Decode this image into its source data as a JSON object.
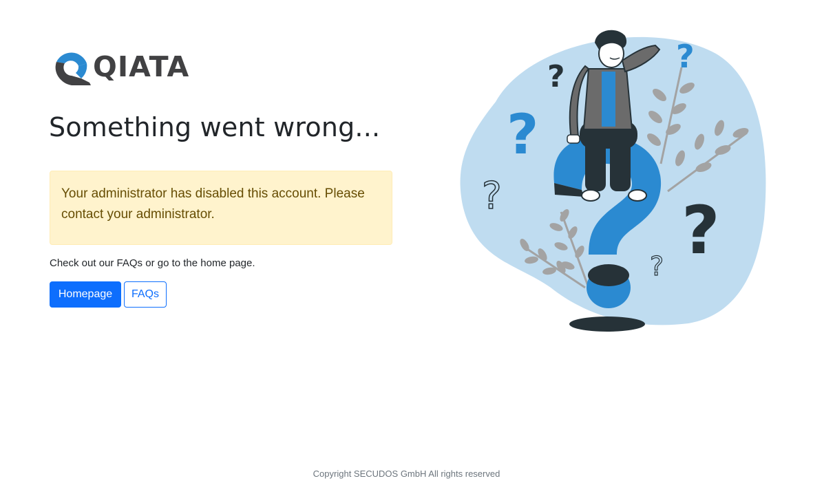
{
  "brand": {
    "name": "QIATA",
    "logo_icon": "qiata-q-logo-icon",
    "colors": {
      "primary_blue": "#2b8ad1",
      "dark_gray": "#414143"
    }
  },
  "page": {
    "title": "Something went wrong..."
  },
  "alert": {
    "message": "Your administrator has disabled this account. Please contact your administrator.",
    "type": "warning",
    "colors": {
      "background": "#fff3cd",
      "text": "#664d03"
    }
  },
  "help": {
    "text": "Check out our FAQs or go to the home page."
  },
  "actions": {
    "homepage_label": "Homepage",
    "faqs_label": "FAQs",
    "colors": {
      "primary": "#0d6efd"
    }
  },
  "illustration": {
    "icon": "confused-person-question-mark-illustration",
    "colors": {
      "blob": "#bfdcf0",
      "accent": "#2b8ad1",
      "dark": "#263238",
      "leaf": "#a3a3a3"
    }
  },
  "footer": {
    "copyright": "Copyright SECUDOS GmbH All rights reserved"
  }
}
